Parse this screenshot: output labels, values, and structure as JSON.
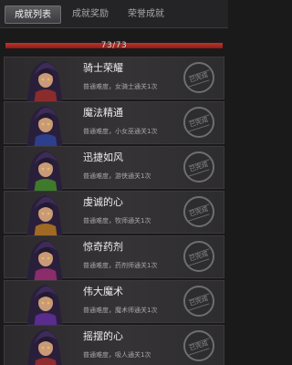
{
  "tabs": [
    "成就列表",
    "成就奖励",
    "荣誉成就"
  ],
  "progress": {
    "text": "73/73",
    "fraction": 1.0
  },
  "achievements": [
    {
      "title": "骑士荣耀",
      "desc": "普通难度，女骑士通关1次",
      "stamp": "已完成",
      "hue": "#8a2c2c"
    },
    {
      "title": "魔法精通",
      "desc": "普通难度，小女巫通关1次",
      "stamp": "已完成",
      "hue": "#2d3f8c"
    },
    {
      "title": "迅捷如风",
      "desc": "普通难度，游侠通关1次",
      "stamp": "已完成",
      "hue": "#3f7a2c"
    },
    {
      "title": "虔诚的心",
      "desc": "普通难度，牧师通关1次",
      "stamp": "已完成",
      "hue": "#a06a24"
    },
    {
      "title": "惊奇药剂",
      "desc": "普通难度，药剂师通关1次",
      "stamp": "已完成",
      "hue": "#8c2c6a"
    },
    {
      "title": "伟大魔术",
      "desc": "普通难度，魔术师通关1次",
      "stamp": "已完成",
      "hue": "#5a2c8c"
    },
    {
      "title": "摇摆的心",
      "desc": "普通难度，吸人通关1次",
      "stamp": "已完成",
      "hue": "#8c2c2c"
    }
  ]
}
